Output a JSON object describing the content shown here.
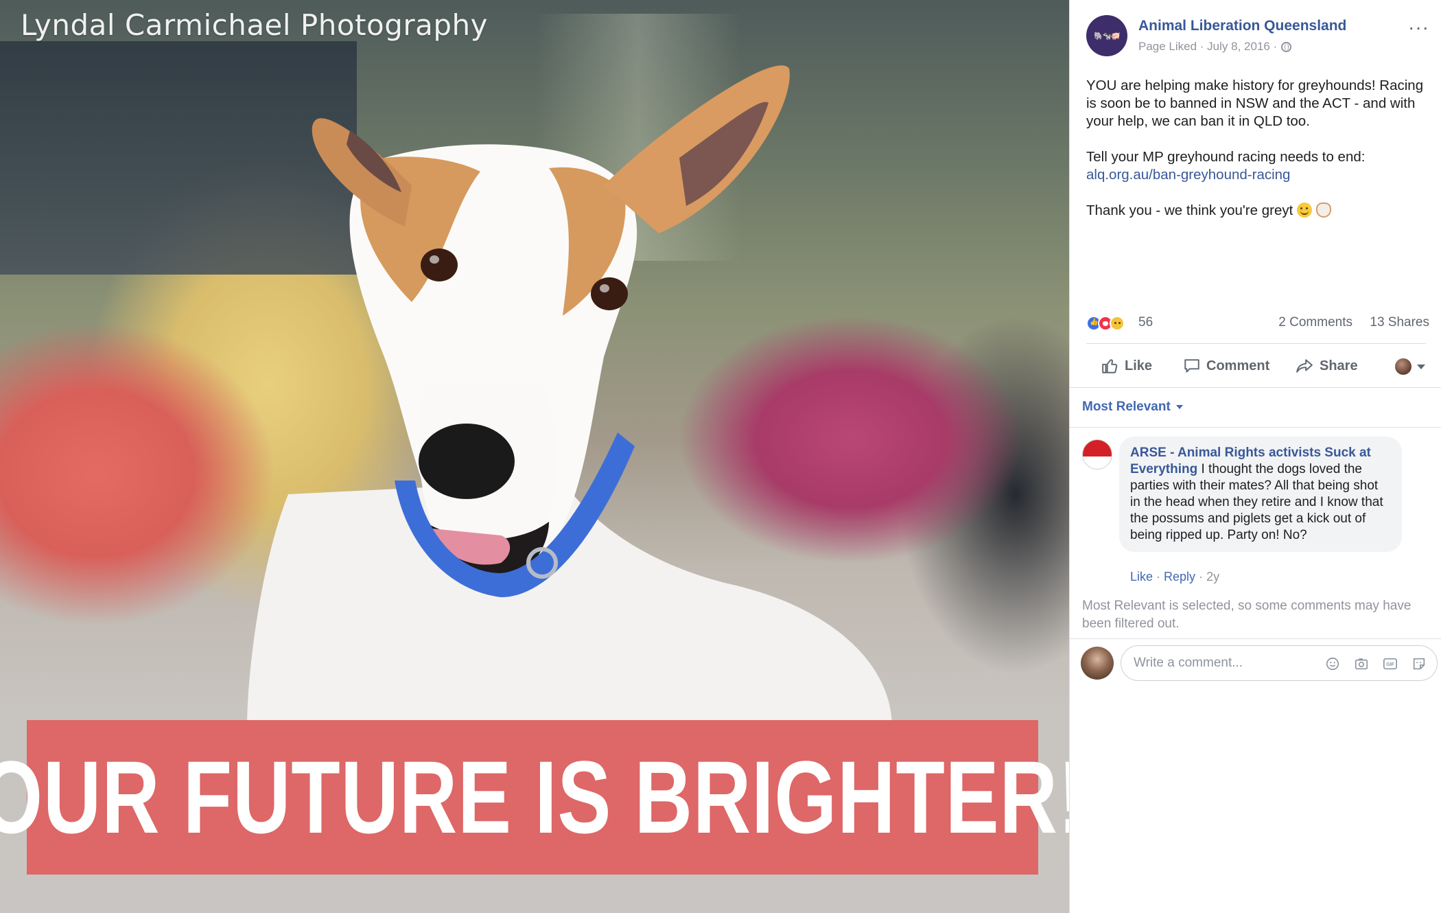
{
  "photo": {
    "watermark": "Lyndal Carmichael Photography",
    "banner_text": "OUR FUTURE IS BRIGHTER!",
    "banner_color": "#de6767"
  },
  "post": {
    "page_name": "Animal Liberation Queensland",
    "meta": "Page Liked · July 8, 2016 ·",
    "body": {
      "para1": "YOU are helping make history for greyhounds! Racing is soon be to banned in NSW and the ACT - and with your help, we can ban it in QLD too.",
      "para2_text": "Tell your MP greyhound racing needs to end:",
      "para2_link": "alq.org.au/ban-greyhound-racing",
      "para3": "Thank you - we think you're greyt"
    },
    "reactions": {
      "count": "56",
      "icons": [
        "like-icon",
        "love-icon",
        "sad-icon"
      ]
    },
    "comments_count": "2 Comments",
    "shares_count": "13 Shares"
  },
  "actions": {
    "like": "Like",
    "comment": "Comment",
    "share": "Share"
  },
  "comments_section": {
    "sort_label": "Most Relevant",
    "comment": {
      "author": "ARSE - Animal Rights activists Suck at Everything",
      "text": "I thought the dogs loved the parties with their mates? All that being shot in the head when they retire and I know that the possums and piglets get a kick out of being ripped up. Party on! No?",
      "like": "Like",
      "reply": "Reply",
      "time": "2y"
    },
    "filter_notice": "Most Relevant is selected, so some comments may have been filtered out.",
    "composer_placeholder": "Write a comment..."
  },
  "colors": {
    "link": "#385898",
    "accent": "#4267b2",
    "muted": "#90949c"
  }
}
